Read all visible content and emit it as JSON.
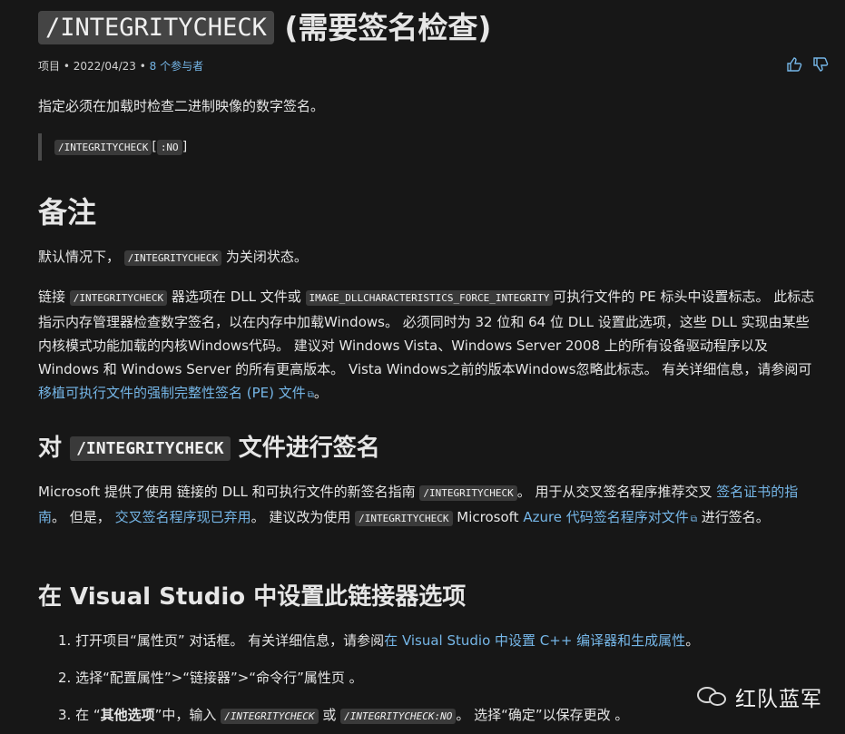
{
  "title": {
    "code": "/INTEGRITYCHECK",
    "text": "(需要签名检查)"
  },
  "meta": {
    "category": "项目",
    "sep1": "•",
    "date": "2022/04/23",
    "sep2": "•",
    "contributors": "8 个参与者"
  },
  "feedback": {
    "like_glyph": "👍",
    "dislike_glyph": "👎"
  },
  "intro": "指定必须在加载时检查二进制映像的数字签名。",
  "syntax": {
    "option": "/INTEGRITYCHECK",
    "bracket_open": "[",
    "arg": ":NO",
    "bracket_close": "]"
  },
  "remarks": {
    "heading": "备注",
    "default_before": "默认情况下，",
    "default_code": "/INTEGRITYCHECK",
    "default_after": "为关闭状态。",
    "p2_a": "链接",
    "p2_code1": "/INTEGRITYCHECK",
    "p2_b": "器选项在 DLL 文件或",
    "p2_code2": "IMAGE_DLLCHARACTERISTICS_FORCE_INTEGRITY",
    "p2_c": "可执行文件的 PE 标头中设置标志。 此标志指示内存管理器检查数字签名，以在内存中加载Windows。 必须同时为 32 位和 64 位 DLL 设置此选项，这些 DLL 实现由某些内核模式功能加载的内核Windows代码。 建议对 Windows Vista、Windows Server 2008 上的所有设备驱动程序以及 Windows 和 Windows Server 的所有更高版本。 Vista Windows之前的版本Windows忽略此标志。 有关详细信息，请参阅可",
    "p2_link": "移植可执行文件的强制完整性签名 (PE) 文件",
    "p2_end": "。"
  },
  "signing": {
    "heading_before": "对",
    "heading_code": "/INTEGRITYCHECK",
    "heading_after": "文件进行签名",
    "p_a": "Microsoft 提供了使用 链接的 DLL 和可执行文件的新签名指南",
    "p_code1": "/INTEGRITYCHECK",
    "p_b": "。 用于从交叉签名程序推荐交叉",
    "p_link1": "签名证书的指南",
    "p_c": "。 但是，",
    "p_link2": "交叉签名程序现已弃用",
    "p_d": "。 建议改为使用",
    "p_code2": "/INTEGRITYCHECK",
    "p_e": "Microsoft",
    "p_link3": "Azure 代码签名程序对文件",
    "p_f": "进行签名。"
  },
  "vs": {
    "heading": "在 Visual Studio 中设置此链接器选项",
    "step1_a": "1. 打开项目“属性页” 对话框。 有关详细信息，请参阅",
    "step1_link": "在 Visual Studio 中设置 C++ 编译器和生成属性",
    "step1_end": "。",
    "step2": "2. 选择“配置属性”>“链接器”>“命令行”属性页 。",
    "step3_a": "3. 在 “",
    "step3_bold": "其他选项",
    "step3_b": "”中，输入",
    "step3_code1": "/INTEGRITYCHECK",
    "step3_c": "或",
    "step3_code2": "/INTEGRITYCHECK:NO",
    "step3_d": "。 选择“确定”以保存更改 。"
  },
  "watermark": {
    "text": "红队蓝军"
  }
}
